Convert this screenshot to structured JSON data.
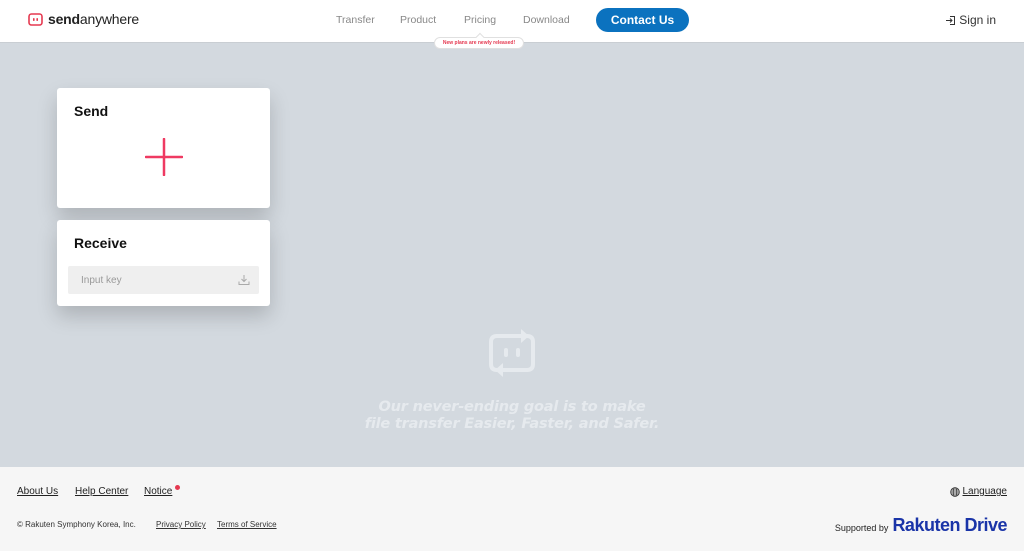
{
  "header": {
    "brand_bold": "send",
    "brand_light": "anywhere",
    "nav": [
      {
        "label": "Transfer"
      },
      {
        "label": "Product"
      },
      {
        "label": "Pricing"
      },
      {
        "label": "Download"
      }
    ],
    "contact_label": "Contact Us",
    "signin_label": "Sign in",
    "tooltip": "New plans are newly released!"
  },
  "send_card": {
    "title": "Send",
    "icon": "plus-icon"
  },
  "receive_card": {
    "title": "Receive",
    "input_placeholder": "Input key",
    "input_value": "",
    "icon": "download-icon"
  },
  "hero": {
    "line1": "Our never-ending goal is to make",
    "line2": "file transfer Easier, Faster, and Safer."
  },
  "footer": {
    "links": [
      {
        "label": "About Us"
      },
      {
        "label": "Help Center"
      },
      {
        "label": "Notice"
      }
    ],
    "copyright": "© Rakuten Symphony Korea, Inc.",
    "privacy": "Privacy Policy",
    "terms": "Terms of Service",
    "language": "Language",
    "supported_by": "Supported by",
    "partner_a": "Rakuten",
    "partner_b": "Drive"
  },
  "colors": {
    "accent": "#0b72bf",
    "brand": "#e53950",
    "background": "#d3d9df"
  }
}
